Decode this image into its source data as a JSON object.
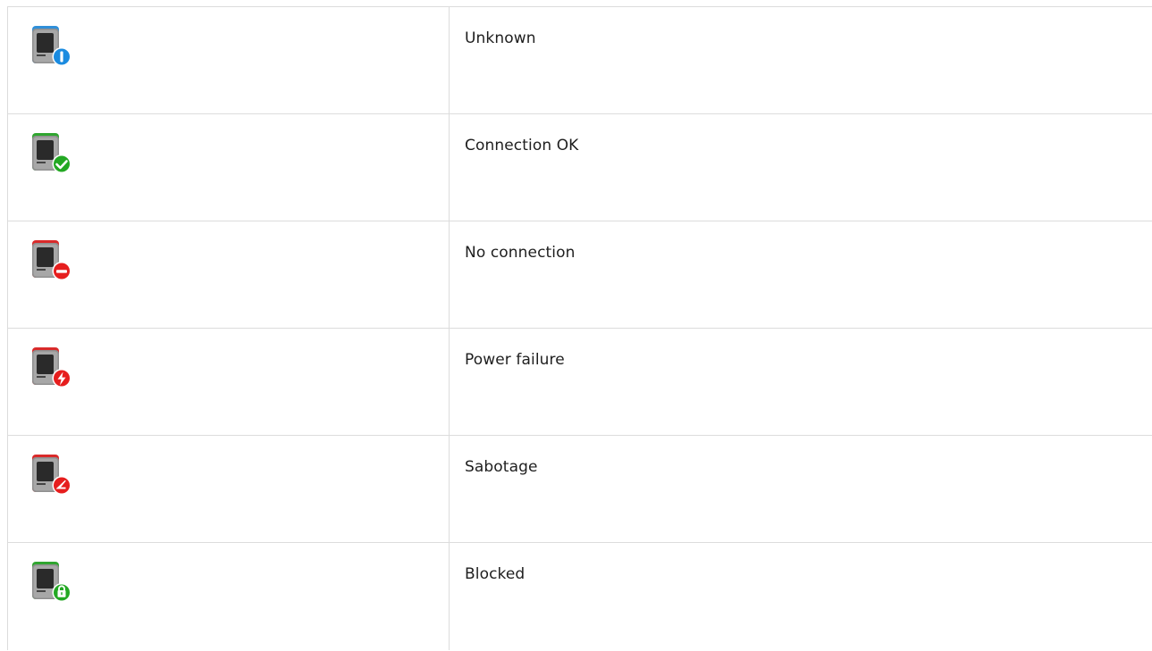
{
  "rows": [
    {
      "status": "Unknown",
      "icon": "device-unknown-icon",
      "top_color": "#2f8fd9",
      "badge_color": "#1a8be0",
      "badge_symbol": "info"
    },
    {
      "status": "Connection OK",
      "icon": "device-connection-ok-icon",
      "top_color": "#2fa52f",
      "badge_color": "#23a823",
      "badge_symbol": "check"
    },
    {
      "status": "No connection",
      "icon": "device-no-connection-icon",
      "top_color": "#d92a2a",
      "badge_color": "#e61e1e",
      "badge_symbol": "minus"
    },
    {
      "status": "Power failure",
      "icon": "device-power-failure-icon",
      "top_color": "#d92a2a",
      "badge_color": "#e61e1e",
      "badge_symbol": "bolt"
    },
    {
      "status": "Sabotage",
      "icon": "device-sabotage-icon",
      "top_color": "#d92a2a",
      "badge_color": "#e61e1e",
      "badge_symbol": "knife"
    },
    {
      "status": "Blocked",
      "icon": "device-blocked-icon",
      "top_color": "#2fa52f",
      "badge_color": "#23a823",
      "badge_symbol": "lock"
    }
  ]
}
